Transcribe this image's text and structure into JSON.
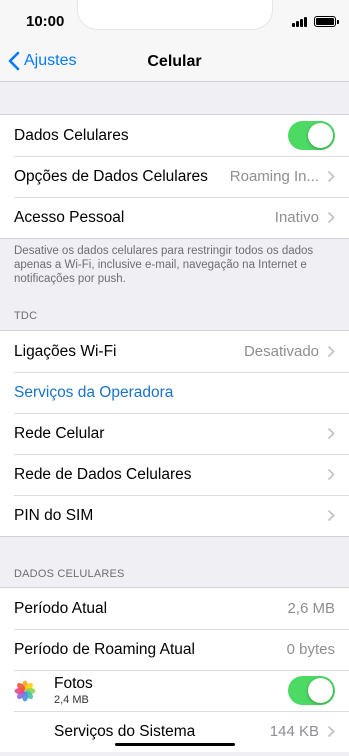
{
  "status_bar": {
    "time": "10:00"
  },
  "nav": {
    "back_label": "Ajustes",
    "title": "Celular"
  },
  "group1": {
    "dados_celulares": {
      "label": "Dados Celulares",
      "toggle_on": true
    },
    "opcoes": {
      "label": "Opções de Dados Celulares",
      "value": "Roaming In..."
    },
    "acesso": {
      "label": "Acesso Pessoal",
      "value": "Inativo"
    }
  },
  "footer_note": "Desative os dados celulares para restringir todos os dados apenas a Wi-Fi, inclusive e-mail, navegação na Internet e notificações por push.",
  "carrier_header": "TDC",
  "group2": {
    "ligacoes": {
      "label": "Ligações Wi-Fi",
      "value": "Desativado"
    },
    "servicos_operadora": {
      "label": "Serviços da Operadora"
    },
    "rede_celular": {
      "label": "Rede Celular"
    },
    "rede_dados": {
      "label": "Rede de Dados Celulares"
    },
    "pin": {
      "label": "PIN do SIM"
    }
  },
  "data_header": "DADOS CELULARES",
  "group3": {
    "periodo_atual": {
      "label": "Período Atual",
      "value": "2,6 MB"
    },
    "periodo_roaming": {
      "label": "Período de Roaming Atual",
      "value": "0 bytes"
    },
    "fotos": {
      "name": "Fotos",
      "size": "2,4 MB",
      "toggle_on": true,
      "icon": "photos-icon"
    },
    "servicos_sistema": {
      "label": "Serviços do Sistema",
      "value": "144 KB"
    }
  },
  "colors": {
    "accent": "#007aff",
    "toggle_on": "#4cd964",
    "background": "#efeff4"
  }
}
